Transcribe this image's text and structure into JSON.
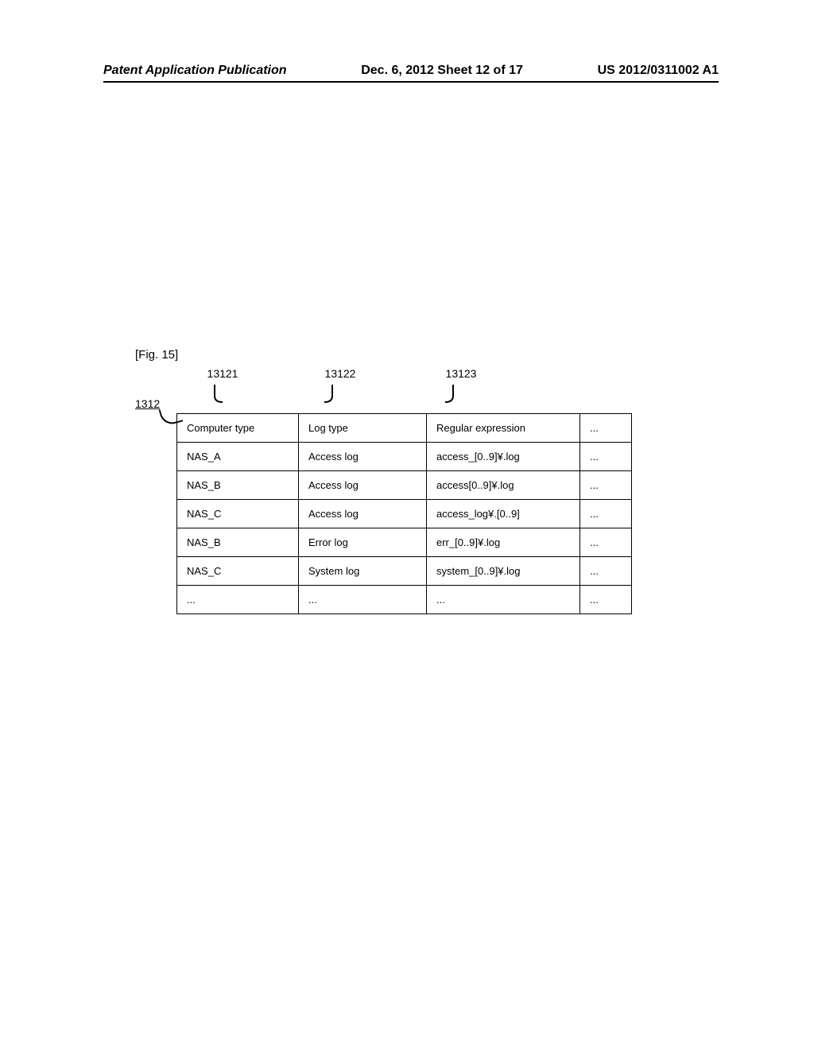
{
  "header": {
    "left": "Patent Application Publication",
    "center": "Dec. 6, 2012  Sheet 12 of 17",
    "right": "US 2012/0311002 A1"
  },
  "figure_label": "[Fig. 15]",
  "refs": {
    "table": "1312",
    "col1": "13121",
    "col2": "13122",
    "col3": "13123"
  },
  "table": {
    "headers": [
      "Computer type",
      "Log type",
      "Regular expression",
      "..."
    ],
    "rows": [
      [
        "NAS_A",
        "Access log",
        "access_[0..9]¥.log",
        "..."
      ],
      [
        "NAS_B",
        "Access log",
        "access[0..9]¥.log",
        "..."
      ],
      [
        "NAS_C",
        "Access log",
        "access_log¥.[0..9]",
        "..."
      ],
      [
        "NAS_B",
        "Error log",
        "err_[0..9]¥.log",
        "..."
      ],
      [
        "NAS_C",
        "System log",
        "system_[0..9]¥.log",
        "..."
      ],
      [
        "...",
        "...",
        "...",
        "..."
      ]
    ]
  }
}
